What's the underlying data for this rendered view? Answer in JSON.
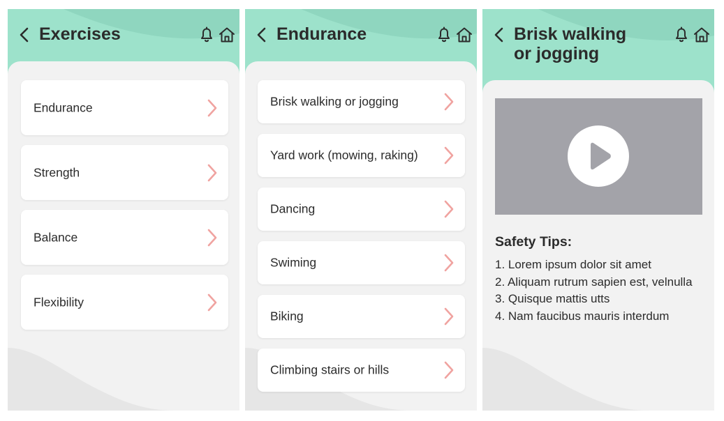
{
  "colors": {
    "header": "#9de2cb",
    "chevron": "#f0a3a0",
    "video_bg": "#a3a3a9"
  },
  "screen1": {
    "title": "Exercises",
    "items": [
      {
        "label": "Endurance"
      },
      {
        "label": "Strength"
      },
      {
        "label": "Balance"
      },
      {
        "label": "Flexibility"
      }
    ]
  },
  "screen2": {
    "title": "Endurance",
    "items": [
      {
        "label": "Brisk walking or jogging"
      },
      {
        "label": "Yard work (mowing, raking)"
      },
      {
        "label": "Dancing"
      },
      {
        "label": "Swiming"
      },
      {
        "label": "Biking"
      },
      {
        "label": "Climbing stairs or hills"
      }
    ]
  },
  "screen3": {
    "title_line1": "Brisk walking",
    "title_line2": "or jogging",
    "tips_title": "Safety Tips:",
    "tips": [
      "1. Lorem ipsum dolor sit amet",
      "2. Aliquam rutrum sapien est, velnulla",
      "3. Quisque mattis utts",
      "4. Nam faucibus mauris interdum"
    ]
  },
  "icons": {
    "back": "chevron-left-icon",
    "bell": "bell-icon",
    "home": "home-icon",
    "chevron": "chevron-right-icon",
    "play": "play-icon"
  }
}
